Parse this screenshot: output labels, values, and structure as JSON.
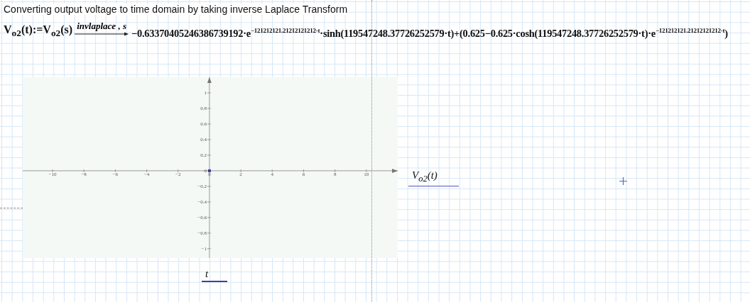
{
  "title": "Converting output voltage to time domain by taking inverse Laplace Transform",
  "equation": {
    "lhs": "V$_{o2}$(t):=V$_{o2}$(s)",
    "operator": "invlaplace , s",
    "result": "−0.63370405246386739192·e$^{−121212121.21212121212·t}$·sinh(119547248.37726252579·t)+(0.625−0.625·cosh(119547248.37726252579·t)·e$^{−121212121.21212121212·t}$)"
  },
  "plot": {
    "y_label": "V$_{o2}$(t)",
    "x_label": "t",
    "chart_data": {
      "type": "scatter",
      "x": [
        0
      ],
      "xlim": [
        -11.9,
        12
      ],
      "ylim": [
        -1.12,
        1.2
      ],
      "series": [
        {
          "color": "#3a3a9a",
          "values": [
            0
          ]
        }
      ],
      "xticks": [
        -10,
        -8,
        -6,
        -4,
        -2,
        0,
        2,
        4,
        6,
        8,
        10
      ],
      "yticks": [
        -1,
        -0.8,
        -0.6,
        -0.4,
        -0.2,
        0,
        0.2,
        0.4,
        0.6,
        0.8,
        1
      ]
    }
  }
}
